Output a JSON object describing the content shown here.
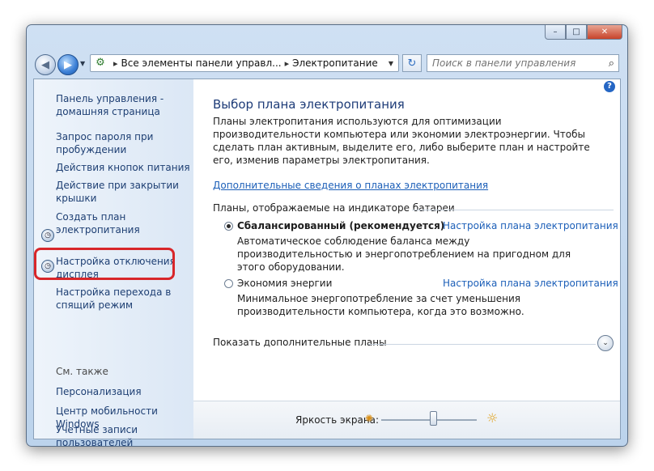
{
  "window": {
    "caption_buttons": {
      "minimize": "–",
      "maximize": "□",
      "close": "✕"
    }
  },
  "toolbar": {
    "back_glyph": "◀",
    "forward_glyph": "▶",
    "history_glyph": "▼",
    "breadcrumb": [
      "Все элементы панели управл...",
      "Электропитание"
    ],
    "crumb_separator": "▸",
    "address_dropdown_glyph": "▼",
    "refresh_glyph": "↻",
    "search_placeholder": "Поиск в панели управления",
    "search_glyph": "⌕"
  },
  "sidebar": {
    "home_link": "Панель управления -\nдомашняя страница",
    "tasks": [
      "Запрос пароля при\nпробуждении",
      "Действия кнопок питания",
      "Действие при закрытии\nкрышки",
      "Создать план электропитания",
      "Настройка отключения\nдисплея",
      "Настройка перехода в\nспящий режим"
    ],
    "task_icon_glyph": "◷",
    "see_also_heading": "См. также",
    "see_also": [
      "Персонализация",
      "Центр мобильности Windows",
      "Учетные записи\nпользователей"
    ]
  },
  "main": {
    "help_glyph": "?",
    "title": "Выбор плана электропитания",
    "intro": "Планы электропитания используются для оптимизации производительности компьютера или экономии электроэнергии. Чтобы сделать план активным, выделите его, либо выберите план и настройте его, изменив параметры электропитания.",
    "intro_link": "Дополнительные сведения о планах электропитания",
    "section_heading": "Планы, отображаемые на индикаторе батареи",
    "plans": [
      {
        "name": "Сбалансированный (рекомендуется)",
        "link": "Настройка плана электропитания",
        "description": "Автоматическое соблюдение баланса между производительностью и энергопотреблением на пригодном для этого оборудовании.",
        "selected": true
      },
      {
        "name": "Экономия энергии",
        "link": "Настройка плана электропитания",
        "description": "Минимальное энергопотребление за счет уменьшения производительности компьютера, когда это возможно.",
        "selected": false
      }
    ],
    "more_plans": "Показать дополнительные планы",
    "expand_glyph": "⌄"
  },
  "brightness": {
    "label": "Яркость экрана:",
    "dim_glyph": "✺",
    "bright_glyph": "☼",
    "level": 0.55
  }
}
